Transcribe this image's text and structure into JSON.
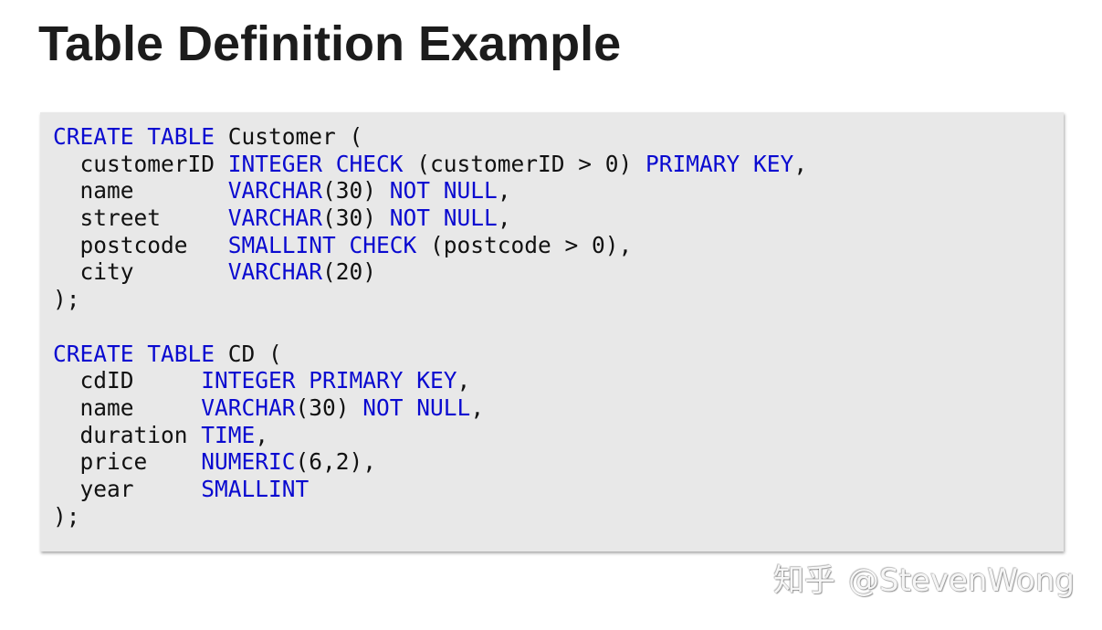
{
  "title": "Table Definition Example",
  "colors": {
    "keyword": "#0a0ad0",
    "plain": "#111111",
    "code_background": "#e8e8e8"
  },
  "code_lines": [
    [
      {
        "t": "CREATE TABLE",
        "k": true
      },
      {
        "t": " Customer (",
        "k": false
      }
    ],
    [
      {
        "t": "  customerID ",
        "k": false
      },
      {
        "t": "INTEGER CHECK",
        "k": true
      },
      {
        "t": " (customerID > 0) ",
        "k": false
      },
      {
        "t": "PRIMARY KEY",
        "k": true
      },
      {
        "t": ",",
        "k": false
      }
    ],
    [
      {
        "t": "  name       ",
        "k": false
      },
      {
        "t": "VARCHAR",
        "k": true
      },
      {
        "t": "(30) ",
        "k": false
      },
      {
        "t": "NOT NULL",
        "k": true
      },
      {
        "t": ",",
        "k": false
      }
    ],
    [
      {
        "t": "  street     ",
        "k": false
      },
      {
        "t": "VARCHAR",
        "k": true
      },
      {
        "t": "(30) ",
        "k": false
      },
      {
        "t": "NOT NULL",
        "k": true
      },
      {
        "t": ",",
        "k": false
      }
    ],
    [
      {
        "t": "  postcode   ",
        "k": false
      },
      {
        "t": "SMALLINT CHECK",
        "k": true
      },
      {
        "t": " (postcode > 0),",
        "k": false
      }
    ],
    [
      {
        "t": "  city       ",
        "k": false
      },
      {
        "t": "VARCHAR",
        "k": true
      },
      {
        "t": "(20)",
        "k": false
      }
    ],
    [
      {
        "t": ");",
        "k": false
      }
    ],
    [],
    [
      {
        "t": "CREATE TABLE",
        "k": true
      },
      {
        "t": " CD (",
        "k": false
      }
    ],
    [
      {
        "t": "  cdID     ",
        "k": false
      },
      {
        "t": "INTEGER PRIMARY KEY",
        "k": true
      },
      {
        "t": ",",
        "k": false
      }
    ],
    [
      {
        "t": "  name     ",
        "k": false
      },
      {
        "t": "VARCHAR",
        "k": true
      },
      {
        "t": "(30) ",
        "k": false
      },
      {
        "t": "NOT NULL",
        "k": true
      },
      {
        "t": ",",
        "k": false
      }
    ],
    [
      {
        "t": "  duration ",
        "k": false
      },
      {
        "t": "TIME",
        "k": true
      },
      {
        "t": ",",
        "k": false
      }
    ],
    [
      {
        "t": "  price    ",
        "k": false
      },
      {
        "t": "NUMERIC",
        "k": true
      },
      {
        "t": "(6,2),",
        "k": false
      }
    ],
    [
      {
        "t": "  year     ",
        "k": false
      },
      {
        "t": "SMALLINT",
        "k": true
      }
    ],
    [
      {
        "t": ");",
        "k": false
      }
    ]
  ],
  "watermark": {
    "site": "知乎",
    "author": "@StevenWong"
  }
}
